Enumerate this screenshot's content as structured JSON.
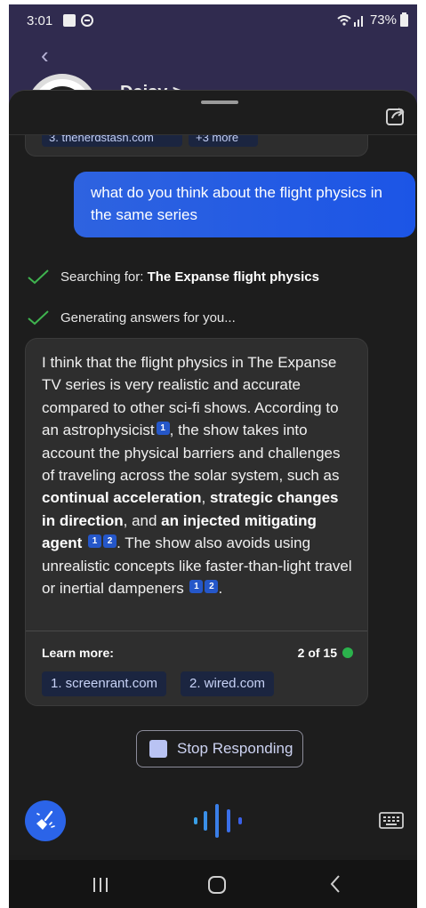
{
  "status_bar": {
    "time": "3:01",
    "battery": "73%"
  },
  "background": {
    "contact_name": "Daisy",
    "name_suffix": " >"
  },
  "previous_card": {
    "chips": [
      "3. thenerdstash.com",
      "+3 more"
    ]
  },
  "conversation": {
    "user_message": "what do you think about the flight physics in the same series",
    "status_searching_prefix": "Searching for: ",
    "status_searching_query": "The Expanse flight physics",
    "status_generating": "Generating answers for you..."
  },
  "answer": {
    "seg1": "I think that the flight physics in The Expanse TV series is very realistic and accurate compared to other sci-fi shows. According to an astrophysicist",
    "cite_a": "1",
    "seg2": ", the show takes into account the physical barriers and challenges of traveling across the solar system, such as ",
    "bold1": "continual acceleration",
    "seg3": ", ",
    "bold2": "strategic changes in direction",
    "seg4": ", and ",
    "bold3": "an injected mitigating agent",
    "cite_b1": "1",
    "cite_b2": "2",
    "seg5": ". The show also avoids using unrealistic concepts like faster-than-light travel or inertial dampeners",
    "cite_c1": "1",
    "cite_c2": "2",
    "seg6": "."
  },
  "learn_more": {
    "label": "Learn more:",
    "counter": "2 of 15",
    "sources": [
      "1. screenrant.com",
      "2. wired.com"
    ]
  },
  "actions": {
    "stop_label": "Stop Responding"
  },
  "colors": {
    "accent_blue": "#2b64e8",
    "status_green": "#2bb24c",
    "card_bg": "#2e2e2e"
  },
  "icons": {
    "share": "share-icon",
    "check": "check-icon",
    "broom": "broom-icon",
    "mic": "mic-wave-icon",
    "keyboard": "keyboard-icon"
  }
}
